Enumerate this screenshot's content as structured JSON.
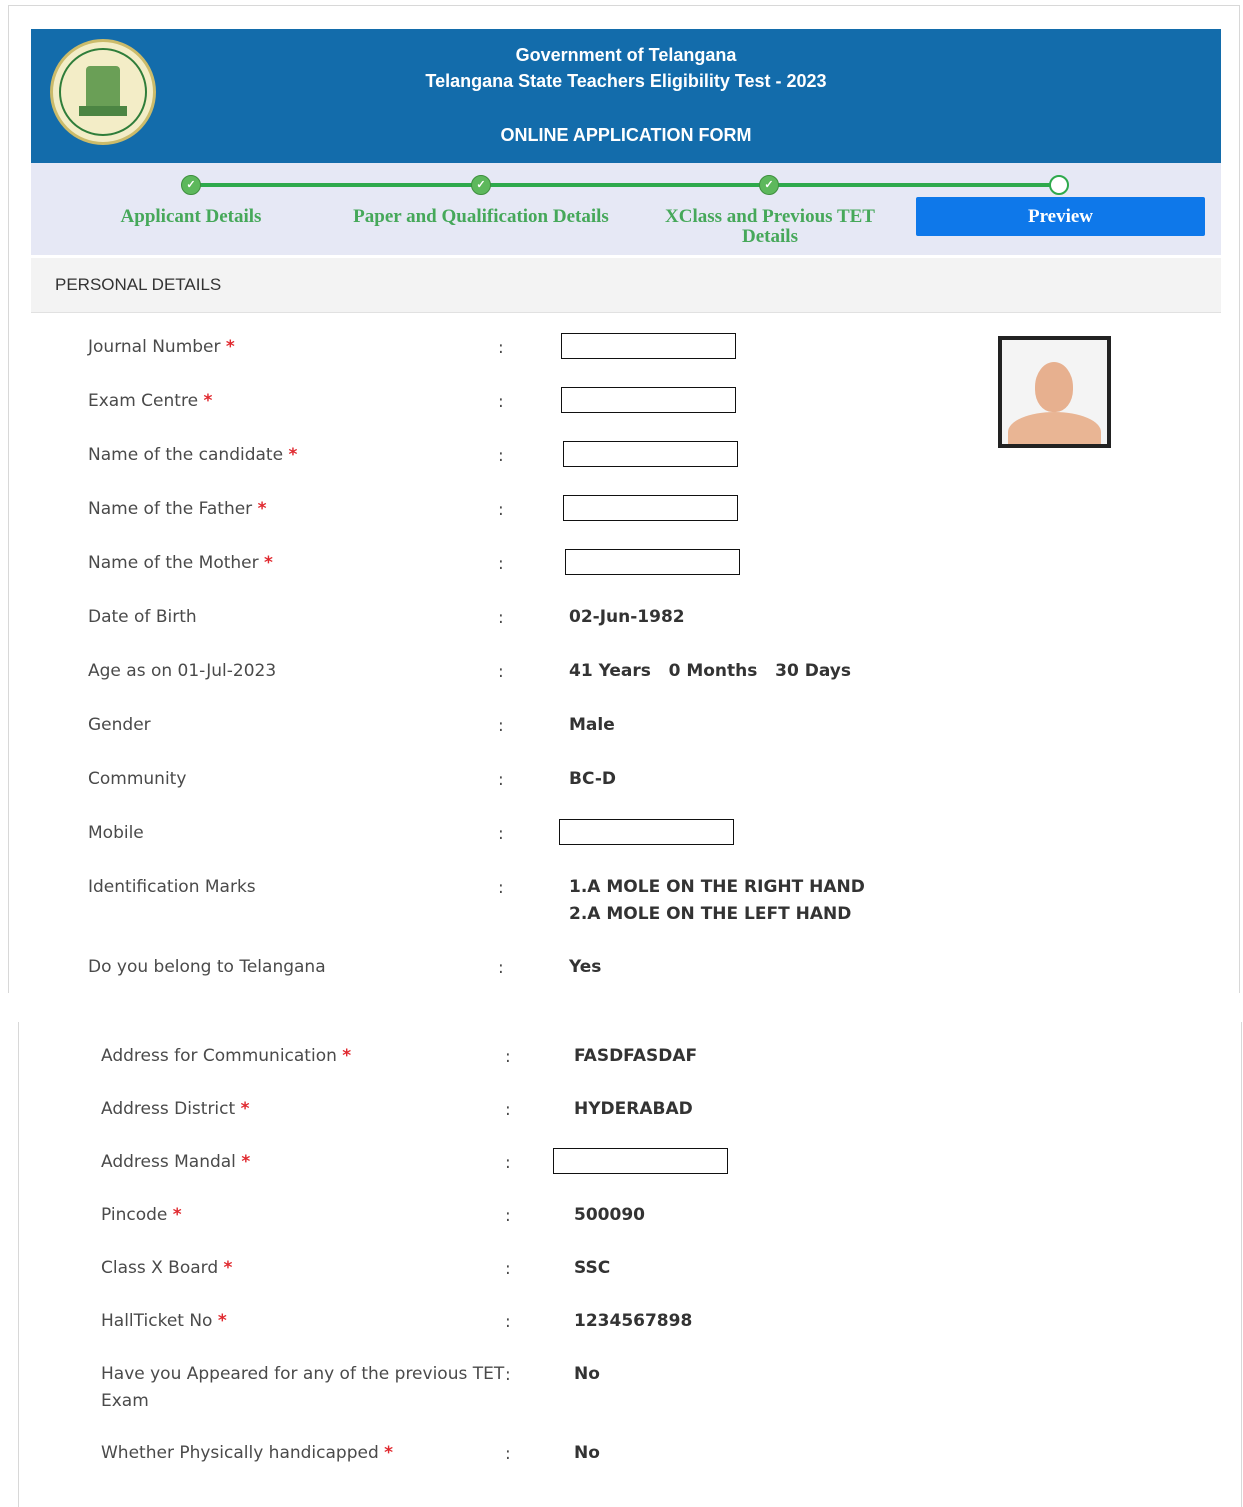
{
  "header": {
    "line1": "Government of Telangana",
    "line2": "Telangana State Teachers Eligibility Test - 2023",
    "line3": "ONLINE APPLICATION FORM"
  },
  "steps": [
    {
      "label": "Applicant Details",
      "state": "done"
    },
    {
      "label": "Paper and Qualification Details",
      "state": "done"
    },
    {
      "label": "XClass and Previous TET Details",
      "state": "done"
    },
    {
      "label": "Preview",
      "state": "current"
    }
  ],
  "section": {
    "title": "PERSONAL DETAILS"
  },
  "required_mark": "*",
  "colon": ":",
  "fields_top": [
    {
      "label": "Journal Number",
      "required": true,
      "value": "",
      "masked": true
    },
    {
      "label": "Exam Centre",
      "required": true,
      "value": "",
      "masked": true
    },
    {
      "label": "Name of the candidate",
      "required": true,
      "value": "",
      "masked": true
    },
    {
      "label": "Name of the Father",
      "required": true,
      "value": "",
      "masked": true
    },
    {
      "label": "Name of the Mother",
      "required": true,
      "value": "",
      "masked": true
    },
    {
      "label": "Date of Birth",
      "required": false,
      "value": "02-Jun-1982"
    },
    {
      "label": "Age as on 01-Jul-2023",
      "required": false,
      "value": "41 Years   0 Months   30 Days"
    },
    {
      "label": "Gender",
      "required": false,
      "value": "Male"
    },
    {
      "label": "Community",
      "required": false,
      "value": "BC-D"
    },
    {
      "label": "Mobile",
      "required": false,
      "value": "",
      "masked": true
    },
    {
      "label": "Identification Marks",
      "required": false,
      "value": "1.A MOLE ON THE RIGHT HAND",
      "value2": "2.A MOLE ON THE LEFT HAND"
    },
    {
      "label": "Do you belong to Telangana",
      "required": false,
      "value": "Yes"
    }
  ],
  "fields_bottom": [
    {
      "label": "Address for Communication",
      "required": true,
      "value": "FASDFASDAF"
    },
    {
      "label": "Address District",
      "required": true,
      "value": "HYDERABAD"
    },
    {
      "label": "Address Mandal",
      "required": true,
      "value": "",
      "masked": true
    },
    {
      "label": "Pincode",
      "required": true,
      "value": "500090"
    },
    {
      "label": "Class X Board",
      "required": true,
      "value": "SSC"
    },
    {
      "label": "HallTicket No",
      "required": true,
      "value": "1234567898"
    },
    {
      "label": "Have you Appeared for any of the previous TET",
      "label2": "Exam",
      "required": false,
      "value": "No"
    },
    {
      "label": "Whether Physically handicapped",
      "required": true,
      "value": "No"
    }
  ]
}
